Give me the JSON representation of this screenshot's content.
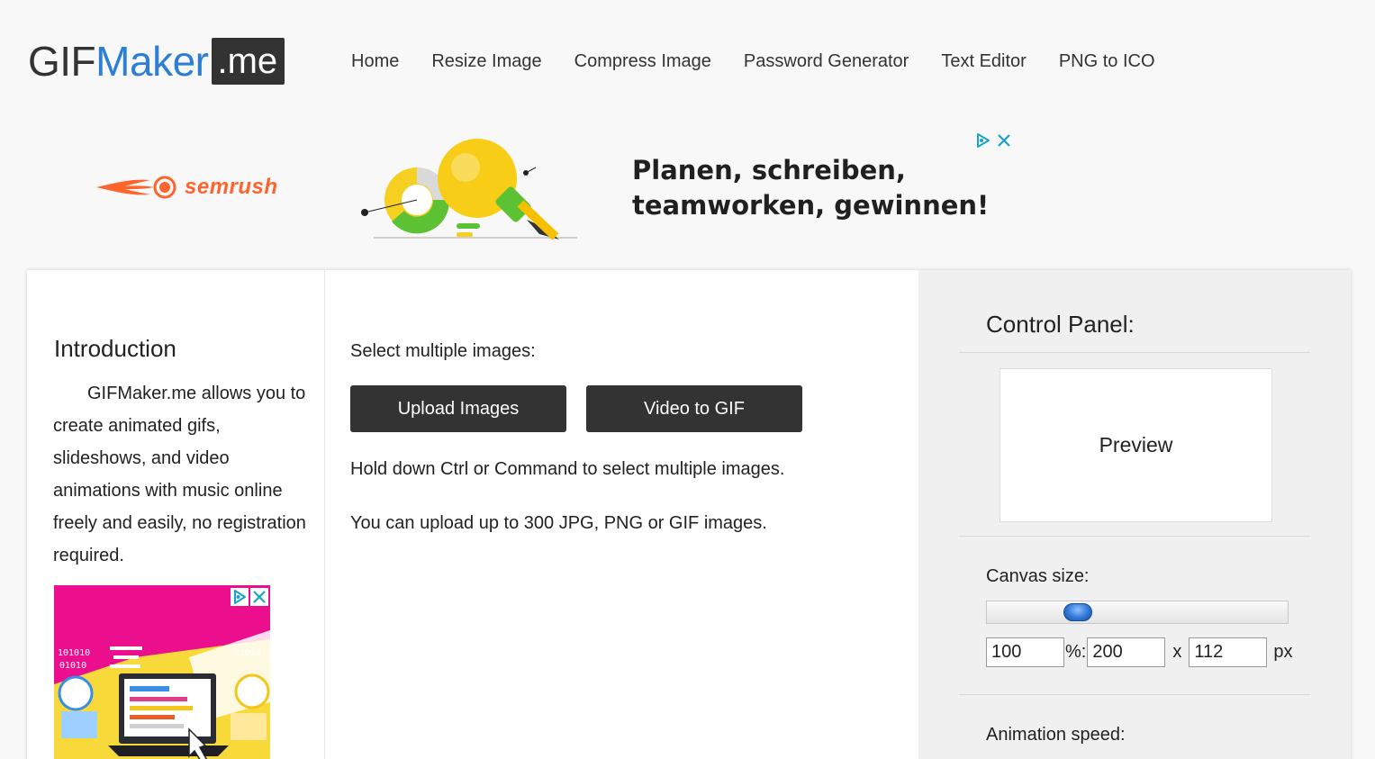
{
  "logo": {
    "part1": "GIF",
    "part2": "Maker",
    "part3": ".me"
  },
  "nav": [
    {
      "label": "Home"
    },
    {
      "label": "Resize Image"
    },
    {
      "label": "Compress Image"
    },
    {
      "label": "Password Generator"
    },
    {
      "label": "Text Editor"
    },
    {
      "label": "PNG to ICO"
    }
  ],
  "top_ad": {
    "brand": "semrush",
    "headline_line1": "Planen, schreiben,",
    "headline_line2": "teamworken, gewinnen!"
  },
  "intro": {
    "title": "Introduction",
    "text": "GIFMaker.me allows you to create animated gifs, slideshows, and video animations with music online freely and easily, no registration required."
  },
  "side_ad": {
    "binary1": "101010",
    "binary2": "01010",
    "binary3": "01010"
  },
  "upload": {
    "select_label": "Select multiple images:",
    "upload_button": "Upload Images",
    "video_button": "Video to GIF",
    "hint1": "Hold down Ctrl or Command to select multiple images.",
    "hint2": "You can upload up to 300 JPG, PNG or GIF images."
  },
  "control_panel": {
    "title": "Control Panel:",
    "preview_label": "Preview",
    "canvas_label": "Canvas size:",
    "canvas_slider_fraction": 0.28,
    "percent_value": "100",
    "percent_sep": "%:",
    "width_value": "200",
    "times": "x",
    "height_value": "112",
    "unit": "px",
    "speed_label": "Animation speed:"
  },
  "colors": {
    "accent_blue": "#2e7ed4",
    "dark_button": "#333333",
    "semrush_orange": "#ff642d",
    "ad_pink": "#ec0f8d"
  }
}
